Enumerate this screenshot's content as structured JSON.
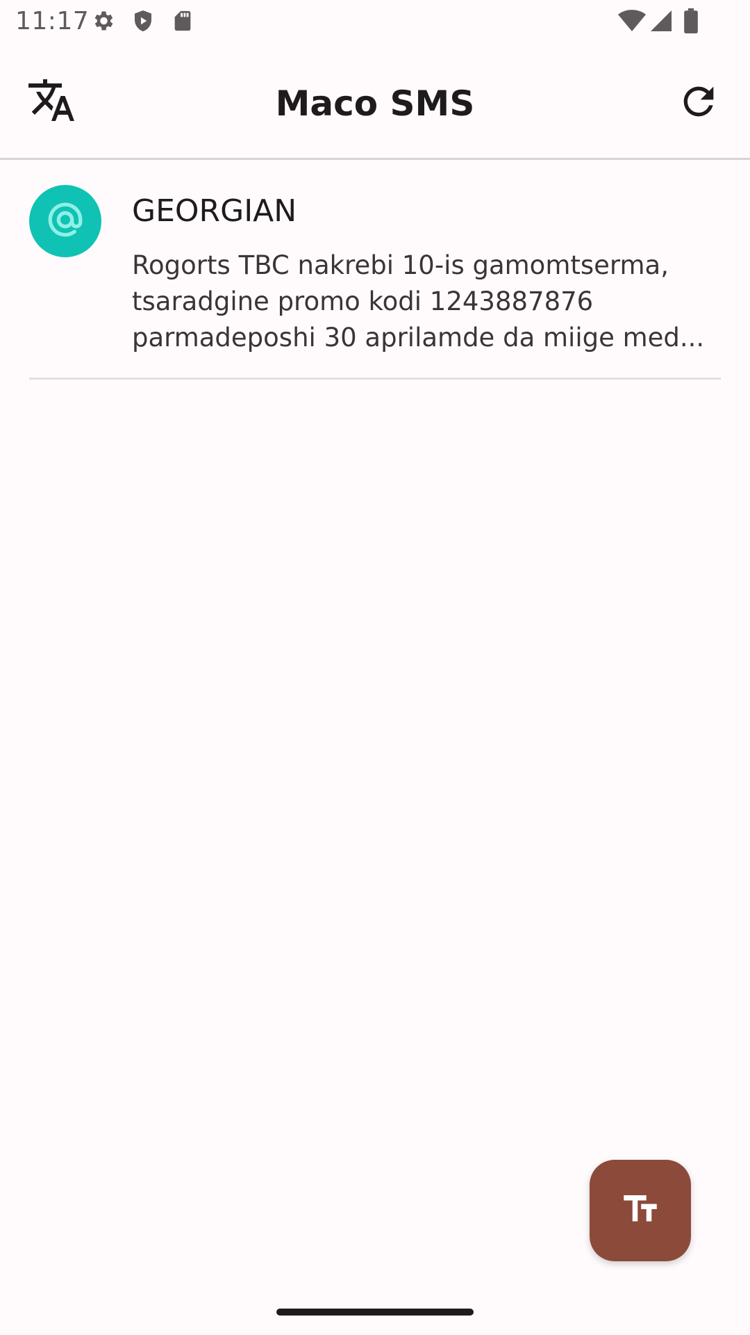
{
  "status_bar": {
    "time": "11:17",
    "icons": [
      "settings-icon",
      "shield-play-icon",
      "sd-card-icon",
      "wifi-icon",
      "signal-icon",
      "battery-icon"
    ]
  },
  "app_bar": {
    "title": "Maco SMS",
    "left_icon": "translate-icon",
    "right_icon": "refresh-icon"
  },
  "messages": [
    {
      "avatar_icon": "at-sign-icon",
      "avatar_color": "#0fc2b4",
      "sender": "GEORGIAN",
      "preview": "Rogorts TBC nakrebi 10-is gamomtserma, tsaradgine promo kodi 1243887876 parmadeposhi 30 aprilamde da miige med..."
    }
  ],
  "fab": {
    "icon": "text-size-icon",
    "color": "#8b4a3a"
  },
  "colors": {
    "background": "#fffbfc",
    "divider": "#d7d2d3",
    "accent": "#8b4a3a"
  }
}
